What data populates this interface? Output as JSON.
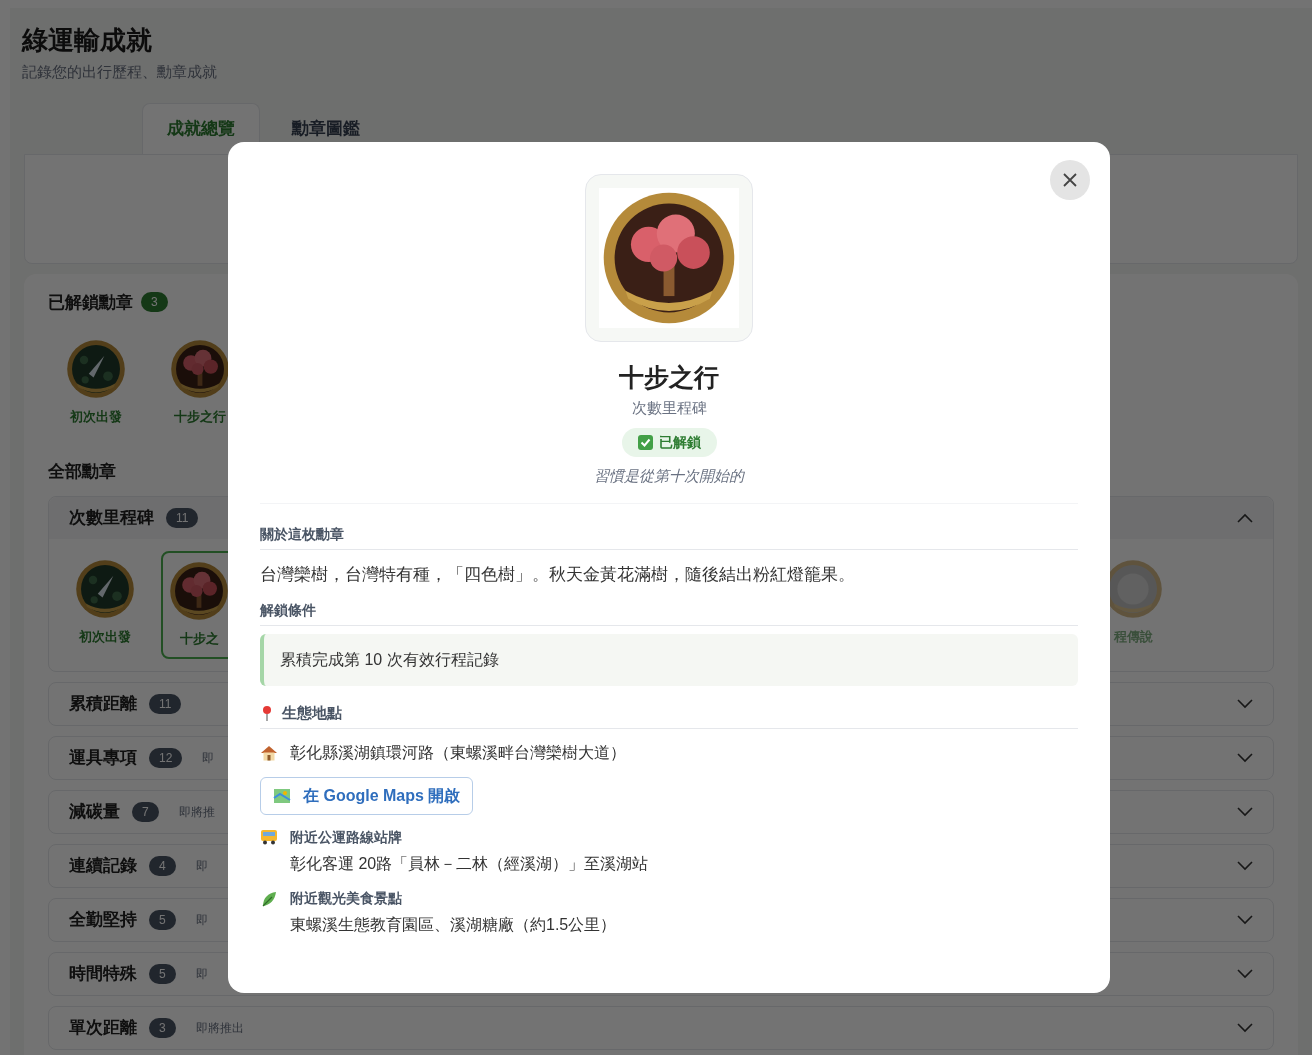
{
  "page": {
    "title": "綠運輸成就",
    "subtitle": "記錄您的出行歷程、勳章成就"
  },
  "tabs": [
    {
      "label": "成就總覽",
      "selected": true
    },
    {
      "label": "勳章圖鑑",
      "selected": false
    }
  ],
  "unlocked": {
    "heading": "已解鎖勳章",
    "count": "3",
    "badges": [
      {
        "name": "初次出發",
        "kind": "rocket"
      },
      {
        "name": "十步之行",
        "kind": "tree"
      }
    ]
  },
  "all_badges": {
    "heading": "全部勳章",
    "categories": [
      {
        "name": "次數里程碑",
        "count": "11",
        "expanded": true,
        "badges": [
          {
            "name": "初次出發",
            "kind": "rocket",
            "selected": false
          },
          {
            "name": "十步之",
            "kind": "tree",
            "selected": true
          },
          {
            "name": "程傳說",
            "kind": "coin",
            "selected": false
          }
        ]
      },
      {
        "name": "累積距離",
        "count": "11",
        "expanded": false
      },
      {
        "name": "運具專項",
        "count": "12",
        "note": "即",
        "expanded": false
      },
      {
        "name": "減碳量",
        "count": "7",
        "note": "即將推",
        "expanded": false
      },
      {
        "name": "連續記錄",
        "count": "4",
        "note": "即",
        "expanded": false
      },
      {
        "name": "全勤堅持",
        "count": "5",
        "note": "即",
        "expanded": false
      },
      {
        "name": "時間特殊",
        "count": "5",
        "note": "即",
        "expanded": false
      },
      {
        "name": "單次距離",
        "count": "3",
        "note": "即將推出",
        "expanded": false
      }
    ]
  },
  "modal": {
    "title": "十步之行",
    "category": "次數里程碑",
    "status": "已解鎖",
    "unlocked": true,
    "quote": "習慣是從第十次開始的",
    "about_heading": "關於這枚勳章",
    "about": "台灣欒樹，台灣特有種，「四色樹」。秋天金黃花滿樹，隨後結出粉紅燈籠果。",
    "condition_heading": "解鎖條件",
    "condition": "累積完成第 10 次有效行程記錄",
    "location_heading": "生態地點",
    "address": "彰化縣溪湖鎮環河路（東螺溪畔台灣欒樹大道）",
    "maps_button": "在 Google Maps 開啟",
    "details": [
      {
        "kind": "bus",
        "heading": "附近公運路線站牌",
        "text": "彰化客運 20路「員林－二林（經溪湖）」至溪湖站"
      },
      {
        "kind": "leaf",
        "heading": "附近觀光美食景點",
        "text": "東螺溪生態教育園區、溪湖糖廠（約1.5公里）"
      }
    ]
  }
}
